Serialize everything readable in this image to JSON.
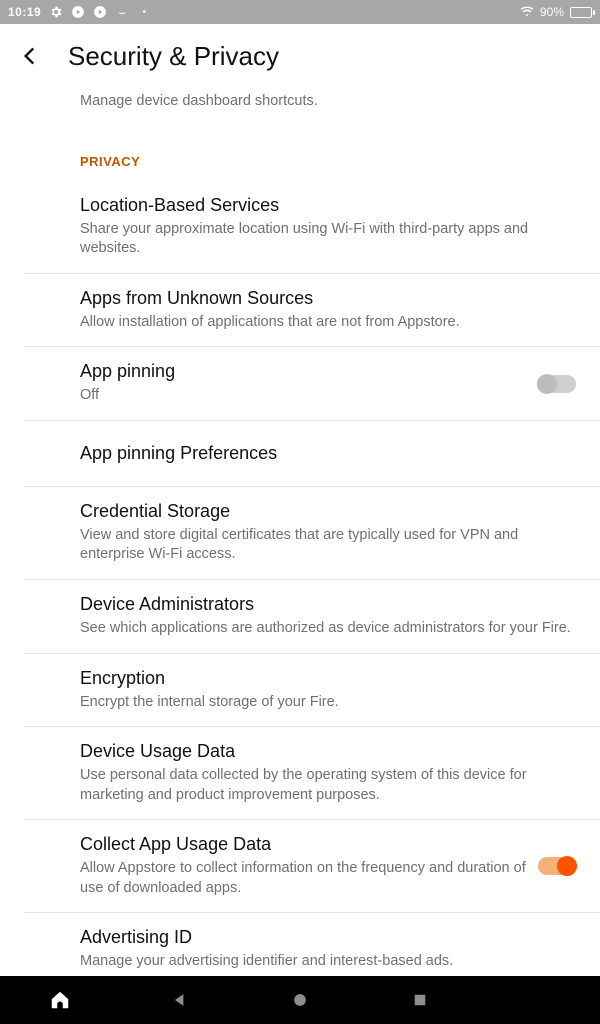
{
  "status": {
    "time": "10:19",
    "battery_pct": "90%",
    "icons": [
      "gear-icon",
      "play-circle-icon",
      "play-circle-icon",
      "smile-icon",
      "dot-icon"
    ]
  },
  "header": {
    "title": "Security & Privacy"
  },
  "partial_row": {
    "sub": "Manage device dashboard shortcuts."
  },
  "section_privacy": "PRIVACY",
  "rows": {
    "location": {
      "title": "Location-Based Services",
      "sub": "Share your approximate location using Wi-Fi with third-party apps and websites."
    },
    "unknown_sources": {
      "title": "Apps from Unknown Sources",
      "sub": "Allow installation of applications that are not from Appstore."
    },
    "app_pinning": {
      "title": "App pinning",
      "sub": "Off",
      "toggle": false
    },
    "app_pinning_prefs": {
      "title": "App pinning Preferences"
    },
    "credential_storage": {
      "title": "Credential Storage",
      "sub": "View and store digital certificates that are typically used for VPN and enterprise Wi-Fi access."
    },
    "device_admins": {
      "title": "Device Administrators",
      "sub": "See which applications are authorized as device administrators for your Fire."
    },
    "encryption": {
      "title": "Encryption",
      "sub": "Encrypt the internal storage of your Fire."
    },
    "device_usage": {
      "title": "Device Usage Data",
      "sub": "Use personal data collected by the operating system of this device for marketing and product improvement purposes."
    },
    "collect_app_usage": {
      "title": "Collect App Usage Data",
      "sub": "Allow Appstore to collect information on the frequency and duration of use of downloaded apps.",
      "toggle": true
    },
    "advertising_id": {
      "title": "Advertising ID",
      "sub": "Manage your advertising identifier and interest-based ads."
    }
  }
}
